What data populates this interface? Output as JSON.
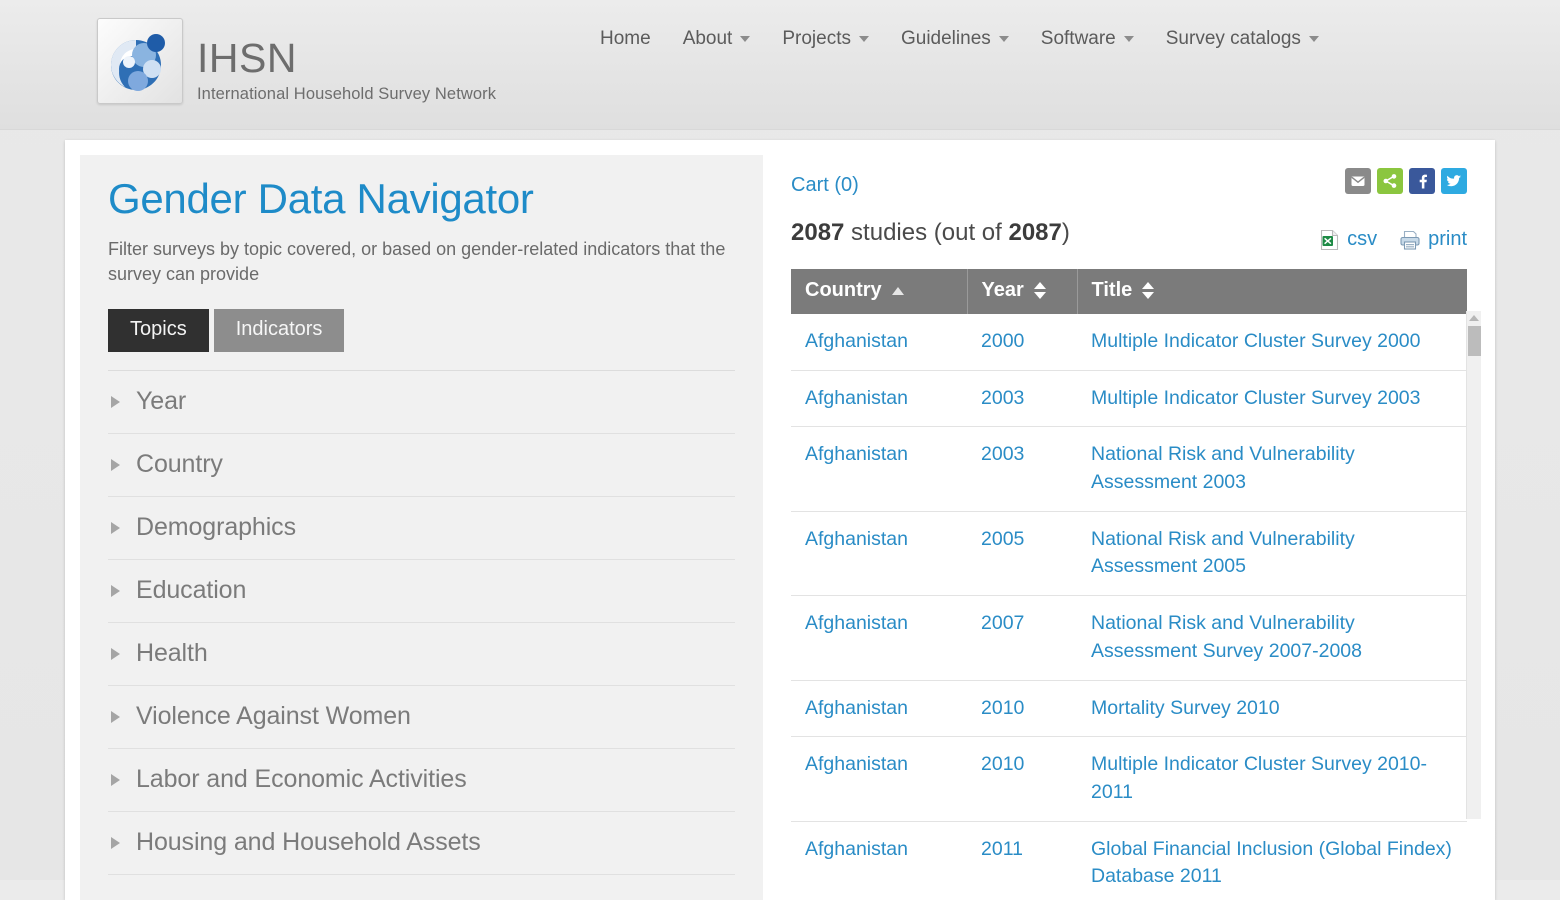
{
  "header": {
    "brand_title": "IHSN",
    "brand_subtitle": "International Household Survey Network",
    "logo_icon": "ihsn-leaf-logo",
    "nav": [
      {
        "label": "Home",
        "has_dropdown": false
      },
      {
        "label": "About",
        "has_dropdown": true
      },
      {
        "label": "Projects",
        "has_dropdown": true
      },
      {
        "label": "Guidelines",
        "has_dropdown": true
      },
      {
        "label": "Software",
        "has_dropdown": true
      },
      {
        "label": "Survey catalogs",
        "has_dropdown": true
      }
    ]
  },
  "left_panel": {
    "title": "Gender Data Navigator",
    "description": "Filter surveys by topic covered, or based on gender-related indicators that the survey can provide",
    "tabs": [
      {
        "label": "Topics",
        "active": true
      },
      {
        "label": "Indicators",
        "active": false
      }
    ],
    "facets": [
      {
        "label": "Year"
      },
      {
        "label": "Country"
      },
      {
        "label": "Demographics"
      },
      {
        "label": "Education"
      },
      {
        "label": "Health"
      },
      {
        "label": "Violence Against Women"
      },
      {
        "label": "Labor and Economic Activities"
      },
      {
        "label": "Housing and Household Assets"
      }
    ]
  },
  "right_panel": {
    "cart_label": "Cart (0)",
    "social_icons": [
      {
        "name": "email-icon",
        "color": "#8a8a8a"
      },
      {
        "name": "share-icon",
        "color": "#8bc63f"
      },
      {
        "name": "facebook-icon",
        "color": "#3a589b"
      },
      {
        "name": "twitter-icon",
        "color": "#2eaae1"
      }
    ],
    "results_count": "2087",
    "results_word": " studies (out of ",
    "results_total": "2087",
    "results_close": ")",
    "export": [
      {
        "label": "csv",
        "icon": "excel-icon"
      },
      {
        "label": "print",
        "icon": "printer-icon"
      }
    ],
    "table": {
      "columns": [
        {
          "label": "Country",
          "sort": "asc"
        },
        {
          "label": "Year",
          "sort": "none"
        },
        {
          "label": "Title",
          "sort": "none"
        }
      ],
      "rows": [
        {
          "country": "Afghanistan",
          "year": "2000",
          "title": "Multiple Indicator Cluster Survey 2000"
        },
        {
          "country": "Afghanistan",
          "year": "2003",
          "title": "Multiple Indicator Cluster Survey 2003"
        },
        {
          "country": "Afghanistan",
          "year": "2003",
          "title": "National Risk and Vulnerability Assessment 2003"
        },
        {
          "country": "Afghanistan",
          "year": "2005",
          "title": "National Risk and Vulnerability Assessment 2005"
        },
        {
          "country": "Afghanistan",
          "year": "2007",
          "title": "National Risk and Vulnerability Assessment Survey 2007-2008"
        },
        {
          "country": "Afghanistan",
          "year": "2010",
          "title": "Mortality Survey 2010"
        },
        {
          "country": "Afghanistan",
          "year": "2010",
          "title": "Multiple Indicator Cluster Survey 2010-2011"
        },
        {
          "country": "Afghanistan",
          "year": "2011",
          "title": "Global Financial Inclusion (Global Findex) Database 2011"
        }
      ]
    }
  },
  "colors": {
    "accent_link": "#2a8cc6",
    "title_blue": "#1e8bc8",
    "tab_active_bg": "#303030",
    "tab_inactive_bg": "#8d8d8d",
    "table_header_bg": "#7b7b7b"
  }
}
